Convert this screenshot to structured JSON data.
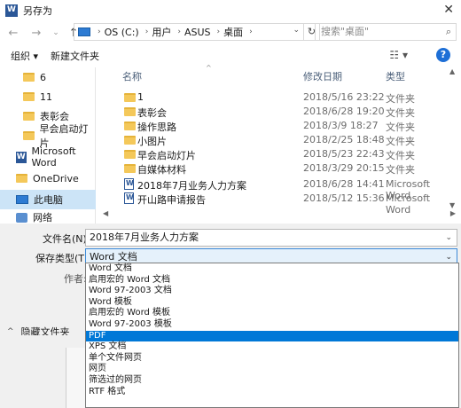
{
  "window": {
    "title": "另存为",
    "close": "✕"
  },
  "nav": {
    "back": "←",
    "forward": "→",
    "recent": "⌄",
    "up": "↑",
    "crumbs": [
      "OS (C:)",
      "用户",
      "ASUS",
      "桌面"
    ],
    "refresh": "↻",
    "search_placeholder": "搜索\"桌面\""
  },
  "toolbar": {
    "organize": "组织 ▾",
    "new_folder": "新建文件夹",
    "help": "?"
  },
  "sidebar": {
    "items": [
      {
        "label": "6",
        "icon": "folder-icon"
      },
      {
        "label": "11",
        "icon": "folder-icon"
      },
      {
        "label": "表彰会",
        "icon": "folder-icon"
      },
      {
        "label": "早会启动灯片",
        "icon": "folder-icon"
      },
      {
        "label": "Microsoft Word",
        "icon": "word-icon"
      },
      {
        "label": "OneDrive",
        "icon": "folder-icon"
      },
      {
        "label": "此电脑",
        "icon": "pc-icon"
      },
      {
        "label": "网络",
        "icon": "network-icon"
      }
    ]
  },
  "files": {
    "headers": {
      "name": "名称",
      "date": "修改日期",
      "type": "类型"
    },
    "rows": [
      {
        "name": "1",
        "date": "2018/5/16 23:22",
        "type": "文件夹",
        "icon": "folder-icon"
      },
      {
        "name": "表彰会",
        "date": "2018/6/28 19:20",
        "type": "文件夹",
        "icon": "folder-icon"
      },
      {
        "name": "操作思路",
        "date": "2018/3/9 18:27",
        "type": "文件夹",
        "icon": "folder-icon"
      },
      {
        "name": "小图片",
        "date": "2018/2/25 18:48",
        "type": "文件夹",
        "icon": "folder-icon"
      },
      {
        "name": "早会启动灯片",
        "date": "2018/5/23 22:43",
        "type": "文件夹",
        "icon": "folder-icon"
      },
      {
        "name": "自媒体材料",
        "date": "2018/3/29 20:15",
        "type": "文件夹",
        "icon": "folder-icon"
      },
      {
        "name": "2018年7月业务人力方案",
        "date": "2018/6/28 14:41",
        "type": "Microsoft Word",
        "icon": "word-doc-icon"
      },
      {
        "name": "开山路申请报告",
        "date": "2018/5/12 15:36",
        "type": "Microsoft Word",
        "icon": "word-doc-icon"
      }
    ]
  },
  "form": {
    "filename_label": "文件名(N):",
    "filename_value": "2018年7月业务人力方案",
    "type_label": "保存类型(T):",
    "type_value": "Word 文档",
    "author_label": "作者:",
    "hide_folders": "隐藏文件夹"
  },
  "type_options": [
    "Word 文档",
    "启用宏的 Word 文档",
    "Word 97-2003 文档",
    "Word 模板",
    "启用宏的 Word 模板",
    "Word 97-2003 模板",
    "PDF",
    "XPS 文档",
    "单个文件网页",
    "网页",
    "筛选过的网页",
    "RTF 格式"
  ],
  "selected_option": "PDF",
  "colors": {
    "accent": "#0078d7",
    "sidebar_selected": "#cce4f7",
    "help": "#1e6fd6"
  }
}
